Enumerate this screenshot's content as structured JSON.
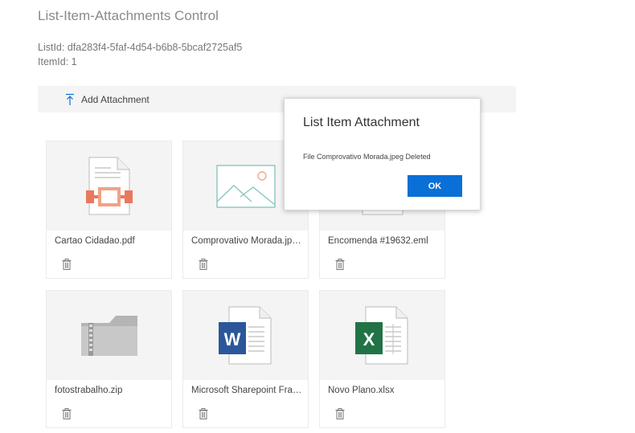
{
  "page": {
    "title": "List-Item-Attachments Control",
    "list_id": "ListId: dfa283f4-5faf-4d54-b6b8-5bcaf2725af5",
    "item_id": "ItemId: 1"
  },
  "toolbar": {
    "add_label": "Add Attachment",
    "add_icon": "upload-arrow-icon"
  },
  "attachments": [
    {
      "name": "Cartao Cidadao.pdf",
      "icon": "pdf-file-icon"
    },
    {
      "name": "Comprovativo Morada.jpeg",
      "icon": "image-file-icon"
    },
    {
      "name": "Encomenda #19632.eml",
      "icon": "email-file-icon"
    },
    {
      "name": "fotostrabalho.zip",
      "icon": "zip-file-icon"
    },
    {
      "name": "Microsoft Sharepoint Framework.docx",
      "icon": "word-file-icon"
    },
    {
      "name": "Novo Plano.xlsx",
      "icon": "excel-file-icon"
    }
  ],
  "dialog": {
    "title": "List Item Attachment",
    "message": "File Comprovativo Morada.jpeg Deleted",
    "ok_label": "OK"
  },
  "colors": {
    "accent": "#0a6fd6",
    "pdf": "#e8795e",
    "word": "#2b579a",
    "excel": "#217346"
  }
}
